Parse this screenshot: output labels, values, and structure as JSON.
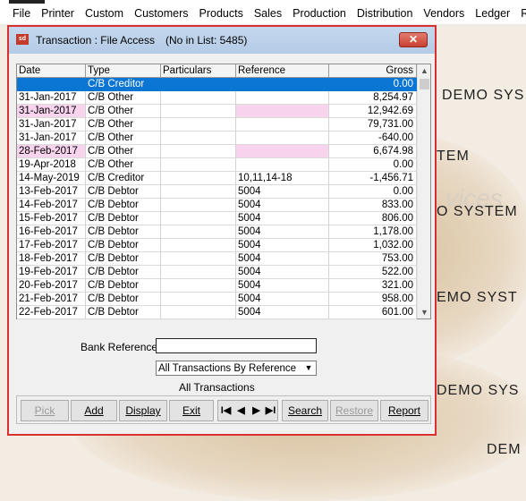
{
  "menubar": {
    "items": [
      "File",
      "Printer",
      "Custom",
      "Customers",
      "Products",
      "Sales",
      "Production",
      "Distribution",
      "Vendors",
      "Ledger",
      "Re"
    ]
  },
  "background": {
    "watermark_lines": [
      "DEMO SYS",
      "TEM",
      "O SYSTEM",
      "EMO SYST",
      "DEMO SYS",
      "DEM"
    ],
    "faded_text": "vices"
  },
  "dialog": {
    "title": "Transaction : File Access",
    "count_text": "(No in List: 5485)",
    "close_label": "✕"
  },
  "grid": {
    "columns": [
      "Date",
      "Type",
      "Particulars",
      "Reference",
      "Gross"
    ],
    "rows": [
      {
        "date": "",
        "type": "C/B Creditor",
        "particulars": "",
        "reference": "",
        "gross": "0.00",
        "selected": true
      },
      {
        "date": "31-Jan-2017",
        "type": "C/B Other",
        "particulars": "",
        "reference": "",
        "gross": "8,254.97"
      },
      {
        "date": "31-Jan-2017",
        "type": "C/B Other",
        "particulars": "",
        "reference": "",
        "gross": "12,942.69",
        "pink": true
      },
      {
        "date": "31-Jan-2017",
        "type": "C/B Other",
        "particulars": "",
        "reference": "",
        "gross": "79,731.00"
      },
      {
        "date": "31-Jan-2017",
        "type": "C/B Other",
        "particulars": "",
        "reference": "",
        "gross": "-640.00"
      },
      {
        "date": "28-Feb-2017",
        "type": "C/B Other",
        "particulars": "",
        "reference": "",
        "gross": "6,674.98",
        "pink": true
      },
      {
        "date": "19-Apr-2018",
        "type": "C/B Other",
        "particulars": "",
        "reference": "",
        "gross": "0.00"
      },
      {
        "date": "14-May-2019",
        "type": "C/B Creditor",
        "particulars": "",
        "reference": "10,11,14-18",
        "gross": "-1,456.71"
      },
      {
        "date": "13-Feb-2017",
        "type": "C/B Debtor",
        "particulars": "",
        "reference": "5004",
        "gross": "0.00"
      },
      {
        "date": "14-Feb-2017",
        "type": "C/B Debtor",
        "particulars": "",
        "reference": "5004",
        "gross": "833.00"
      },
      {
        "date": "15-Feb-2017",
        "type": "C/B Debtor",
        "particulars": "",
        "reference": "5004",
        "gross": "806.00"
      },
      {
        "date": "16-Feb-2017",
        "type": "C/B Debtor",
        "particulars": "",
        "reference": "5004",
        "gross": "1,178.00"
      },
      {
        "date": "17-Feb-2017",
        "type": "C/B Debtor",
        "particulars": "",
        "reference": "5004",
        "gross": "1,032.00"
      },
      {
        "date": "18-Feb-2017",
        "type": "C/B Debtor",
        "particulars": "",
        "reference": "5004",
        "gross": "753.00"
      },
      {
        "date": "19-Feb-2017",
        "type": "C/B Debtor",
        "particulars": "",
        "reference": "5004",
        "gross": "522.00"
      },
      {
        "date": "20-Feb-2017",
        "type": "C/B Debtor",
        "particulars": "",
        "reference": "5004",
        "gross": "321.00"
      },
      {
        "date": "21-Feb-2017",
        "type": "C/B Debtor",
        "particulars": "",
        "reference": "5004",
        "gross": "958.00"
      },
      {
        "date": "22-Feb-2017",
        "type": "C/B Debtor",
        "particulars": "",
        "reference": "5004",
        "gross": "601.00"
      }
    ]
  },
  "form": {
    "bank_reference_label": "Bank Reference",
    "bank_reference_value": "",
    "filter_selected": "All Transactions By Reference",
    "filter_caption": "All Transactions"
  },
  "buttons": {
    "pick": "Pick",
    "add": "Add",
    "display": "Display",
    "exit": "Exit",
    "nav_first": "I◀",
    "nav_prev": "◀",
    "nav_next": "▶",
    "nav_last": "▶I",
    "search": "Search",
    "restore": "Restore",
    "report": "Report"
  },
  "colors": {
    "selection": "#0a75d2",
    "highlight_pink": "#f7d3ee",
    "dialog_border": "#d93030"
  }
}
